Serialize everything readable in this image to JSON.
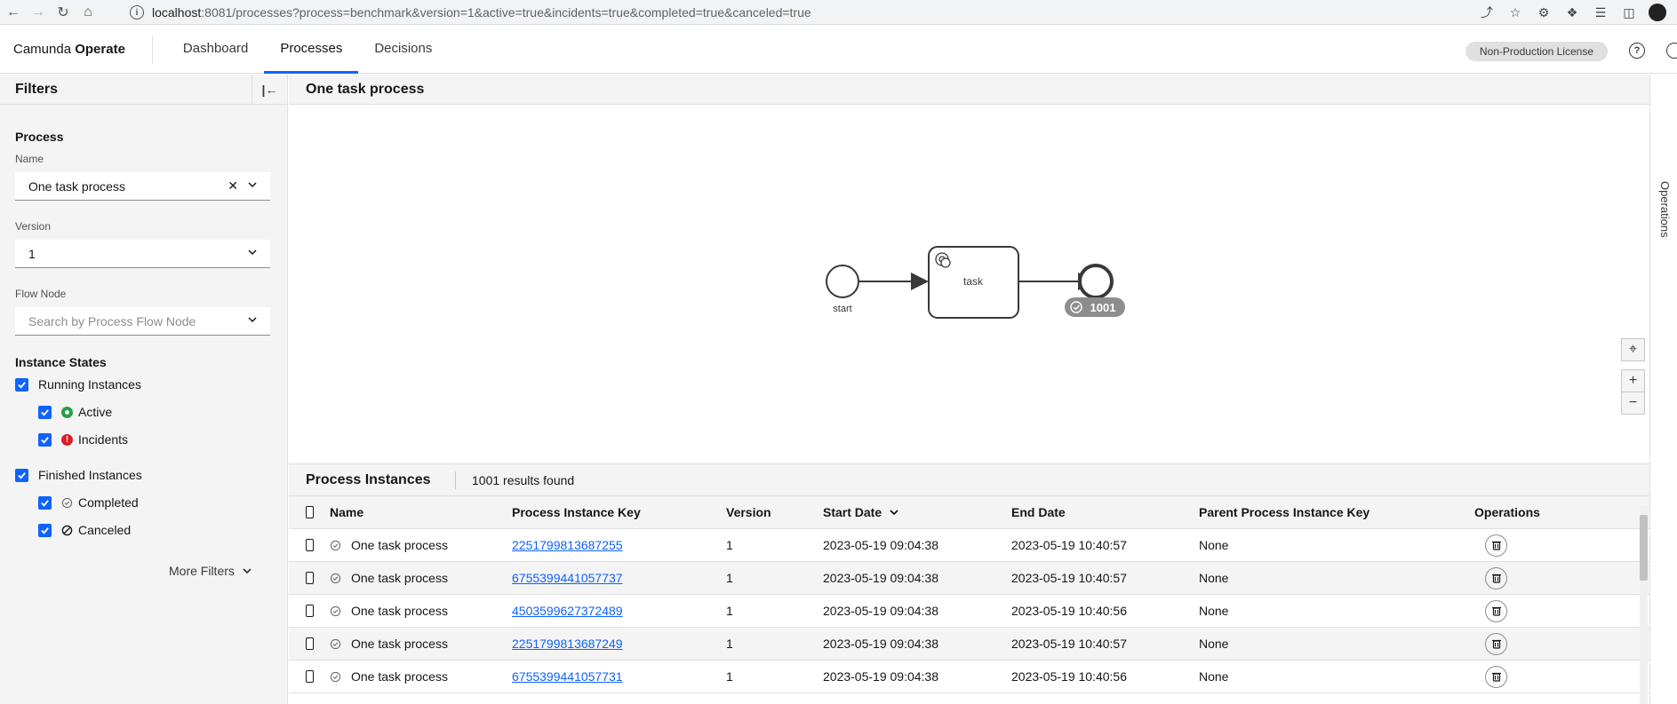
{
  "browser": {
    "url_host": "localhost",
    "url_rest": ":8081/processes?process=benchmark&version=1&active=true&incidents=true&completed=true&canceled=true"
  },
  "header": {
    "brand_prefix": "Camunda",
    "brand_name": "Operate",
    "tabs": [
      {
        "label": "Dashboard"
      },
      {
        "label": "Processes"
      },
      {
        "label": "Decisions"
      }
    ],
    "license": "Non-Production License"
  },
  "filters": {
    "title": "Filters",
    "process_section": "Process",
    "name_label": "Name",
    "name_value": "One task process",
    "version_label": "Version",
    "version_value": "1",
    "flow_node_label": "Flow Node",
    "flow_node_placeholder": "Search by Process Flow Node",
    "states_section": "Instance States",
    "running": "Running Instances",
    "active": "Active",
    "incidents": "Incidents",
    "finished": "Finished Instances",
    "completed": "Completed",
    "canceled": "Canceled",
    "more_filters": "More Filters"
  },
  "diagram": {
    "title": "One task process",
    "start_label": "start",
    "task_label": "task",
    "end_badge": "1001"
  },
  "instances": {
    "title": "Process Instances",
    "count": "1001 results found",
    "columns": [
      "Name",
      "Process Instance Key",
      "Version",
      "Start Date",
      "End Date",
      "Parent Process Instance Key",
      "Operations"
    ],
    "rows": [
      {
        "name": "One task process",
        "key": "2251799813687255",
        "version": "1",
        "start": "2023-05-19 09:04:38",
        "end": "2023-05-19 10:40:57",
        "parent": "None"
      },
      {
        "name": "One task process",
        "key": "6755399441057737",
        "version": "1",
        "start": "2023-05-19 09:04:38",
        "end": "2023-05-19 10:40:57",
        "parent": "None"
      },
      {
        "name": "One task process",
        "key": "4503599627372489",
        "version": "1",
        "start": "2023-05-19 09:04:38",
        "end": "2023-05-19 10:40:56",
        "parent": "None"
      },
      {
        "name": "One task process",
        "key": "2251799813687249",
        "version": "1",
        "start": "2023-05-19 09:04:38",
        "end": "2023-05-19 10:40:57",
        "parent": "None"
      },
      {
        "name": "One task process",
        "key": "6755399441057731",
        "version": "1",
        "start": "2023-05-19 09:04:38",
        "end": "2023-05-19 10:40:56",
        "parent": "None"
      }
    ]
  },
  "rail": {
    "label": "Operations"
  },
  "colors": {
    "accent": "#0f62fe",
    "active": "#24a148",
    "incident": "#da1e28"
  }
}
